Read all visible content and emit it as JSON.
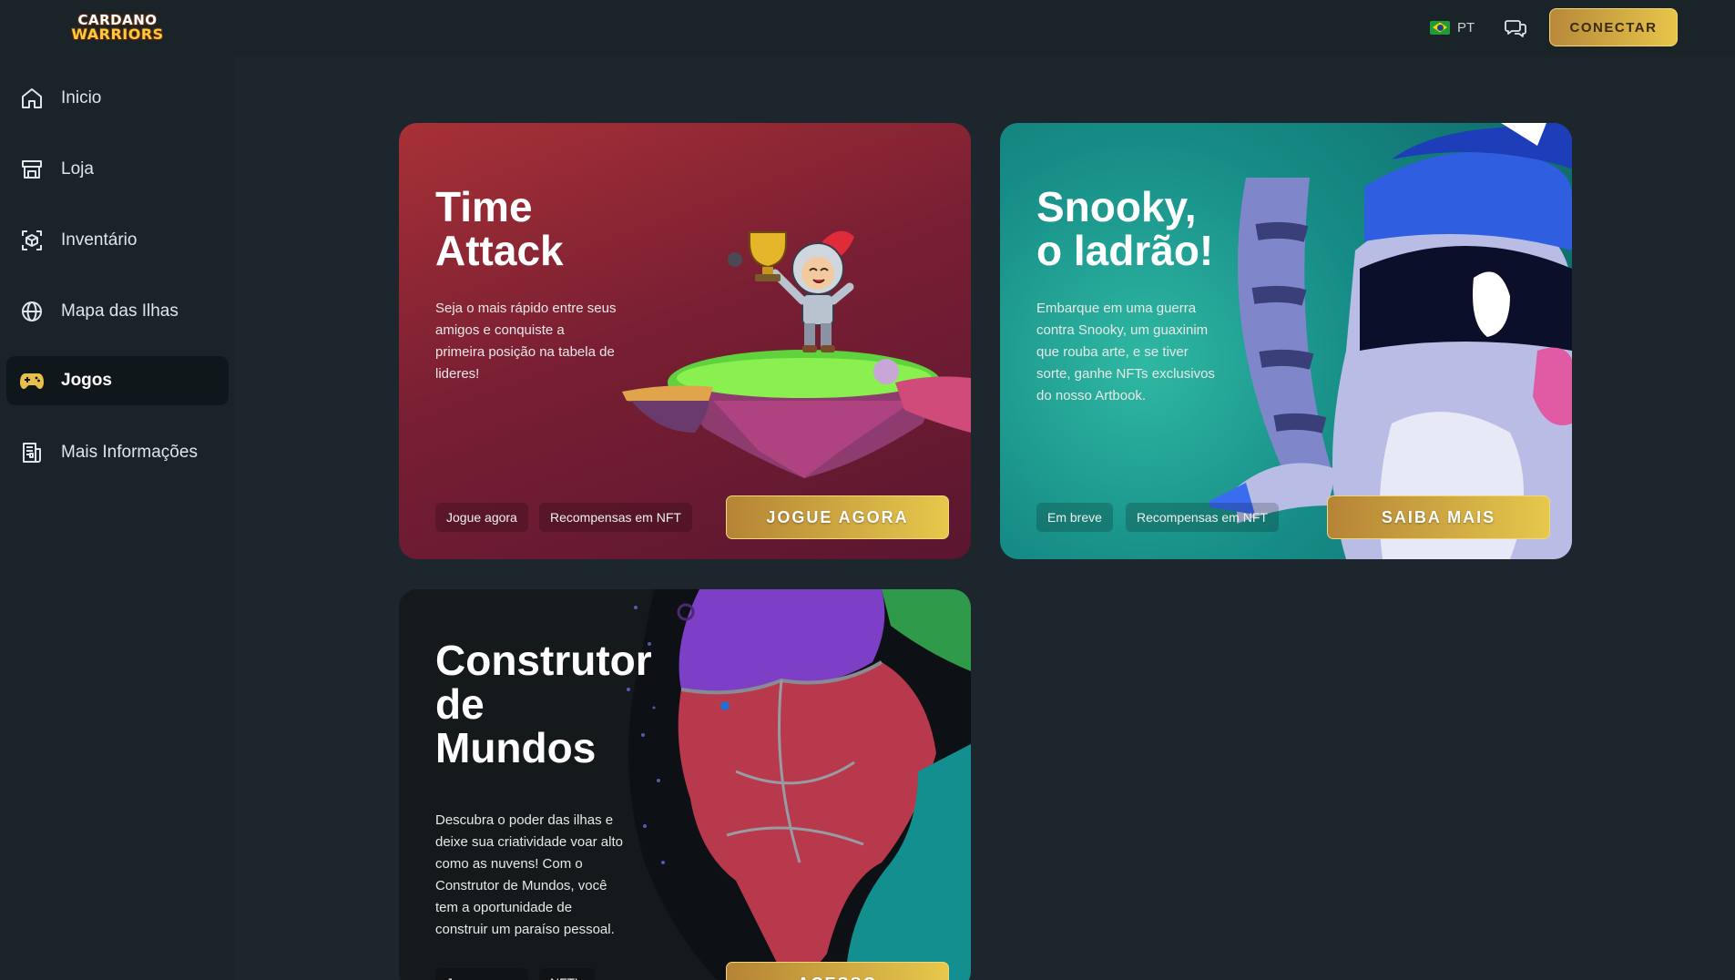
{
  "header": {
    "logo_line1": "CARDANO",
    "logo_line2": "WARRIORS",
    "language": "PT",
    "connect_label": "CONECTAR"
  },
  "sidebar": {
    "items": [
      {
        "label": "Inicio",
        "icon": "home-icon"
      },
      {
        "label": "Loja",
        "icon": "store-icon"
      },
      {
        "label": "Inventário",
        "icon": "inventory-icon"
      },
      {
        "label": "Mapa das Ilhas",
        "icon": "globe-icon"
      },
      {
        "label": "Jogos",
        "icon": "gamepad-icon",
        "active": true
      },
      {
        "label": "Mais Informações",
        "icon": "document-icon"
      }
    ]
  },
  "cards": [
    {
      "title": "  Time\nAttack",
      "description": "Seja o mais rápido entre seus amigos e conquiste a primeira posição na tabela de lideres!",
      "tags": [
        "Jogue agora",
        "Recompensas em NFT"
      ],
      "cta": "JOGUE AGORA"
    },
    {
      "title": "  Snooky,\n o ladrão!",
      "description": "Embarque em uma guerra contra Snooky, um guaxinim que rouba arte, e se tiver sorte, ganhe NFTs exclusivos do nosso Artbook.",
      "tags": [
        "Em breve",
        "Recompensas em NFT"
      ],
      "cta": "SAIBA MAIS"
    },
    {
      "title": "Construtor\n    de\nMundos",
      "description": "Descubra o poder das ilhas e deixe sua criatividade voar alto como as nuvens! Com o Construtor de Mundos, você tem a oportunidade de construir um paraíso pessoal.",
      "tags": [
        "Jogue agora",
        "NFT's"
      ],
      "cta": "ACESSO"
    }
  ],
  "colors": {
    "accent_gold": "#e7c54a",
    "background": "#1c262c",
    "sidebar": "#1a2328"
  }
}
